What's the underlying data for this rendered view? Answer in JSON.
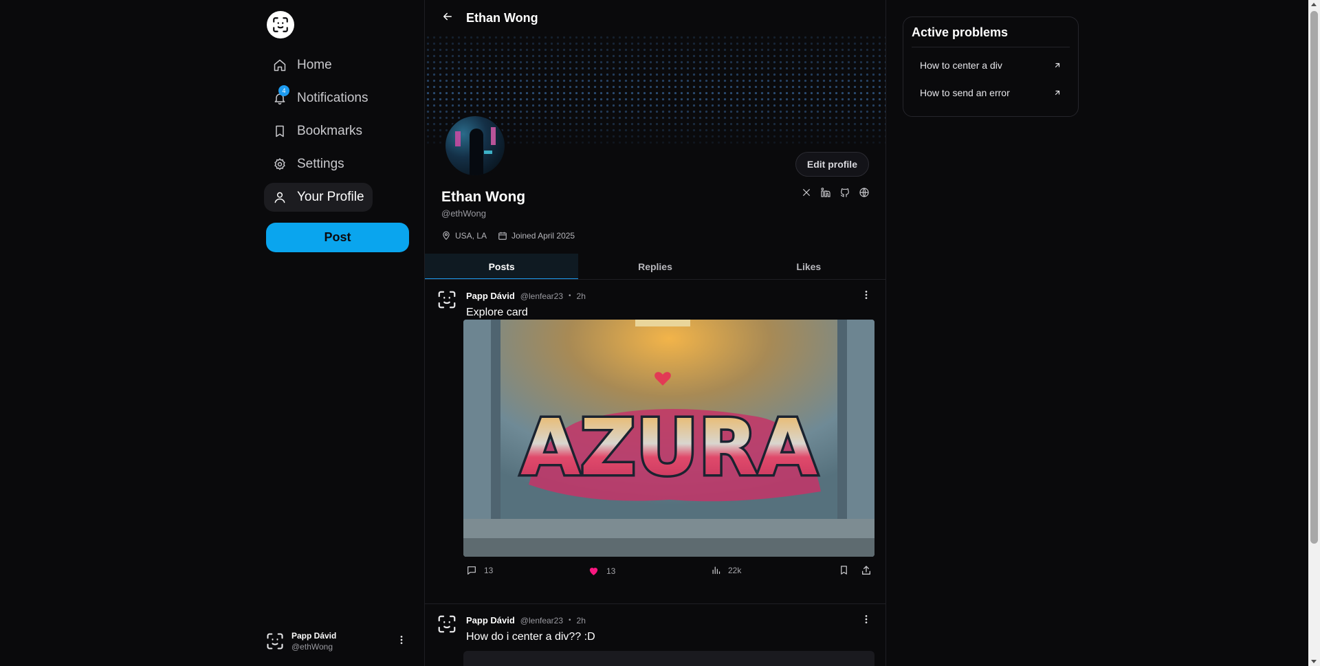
{
  "sidebar": {
    "items": [
      {
        "label": "Home",
        "icon": "home-icon"
      },
      {
        "label": "Notifications",
        "icon": "bell-icon",
        "badge": "4"
      },
      {
        "label": "Bookmarks",
        "icon": "bookmark-icon"
      },
      {
        "label": "Settings",
        "icon": "gear-icon"
      },
      {
        "label": "Your Profile",
        "icon": "user-icon",
        "active": true
      }
    ],
    "post_label": "Post",
    "account": {
      "name": "Papp Dávid",
      "handle": "@ethWong"
    }
  },
  "header": {
    "title": "Ethan Wong"
  },
  "profile": {
    "name": "Ethan Wong",
    "handle": "@ethWong",
    "location": "USA, LA",
    "joined": "Joined April 2025",
    "edit_label": "Edit profile"
  },
  "tabs": [
    {
      "label": "Posts",
      "active": true
    },
    {
      "label": "Replies"
    },
    {
      "label": "Likes"
    }
  ],
  "posts": [
    {
      "author": "Papp Dávid",
      "handle": "@lenfear23",
      "time": "2h",
      "text": "Explore card",
      "image_text": "AZURA",
      "comments": "13",
      "likes": "13",
      "views": "22k",
      "liked": true
    },
    {
      "author": "Papp Dávid",
      "handle": "@lenfear23",
      "time": "2h",
      "text": "How do i center a div?? :D"
    }
  ],
  "right": {
    "title": "Active problems",
    "items": [
      {
        "label": "How to center a div"
      },
      {
        "label": "How to send an error"
      }
    ]
  },
  "colors": {
    "accent": "#0aa5ee",
    "like": "#f91880",
    "background": "#0a0a0c"
  }
}
